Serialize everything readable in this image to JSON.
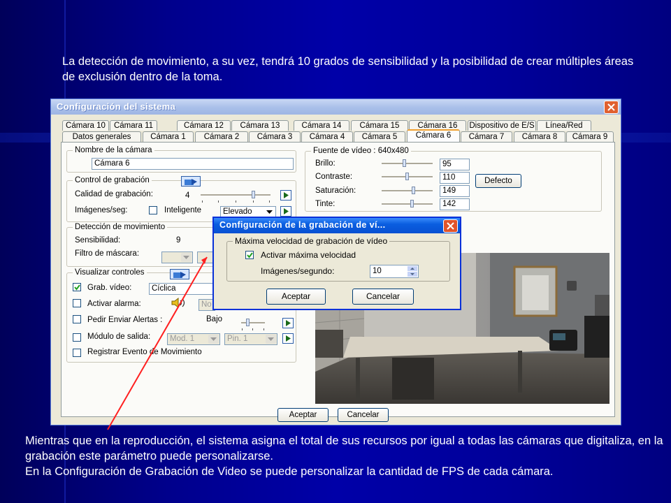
{
  "slide": {
    "top_text": "La detección de movimiento, a su vez, tendrá 10 grados de sensibilidad y la posibilidad de crear múltiples áreas de exclusión dentro de la toma.",
    "bottom_line1": "Mientras que en la reproducción, el sistema asigna el total de sus recursos por igual a todas las cámaras que digitaliza, en la grabación este parámetro puede personalizarse.",
    "bottom_line2": "En la Configuración de Grabación de Video se puede personalizar la cantidad de FPS de cada cámara."
  },
  "window": {
    "title": "Configuración del sistema",
    "tabs_row1": [
      "Cámara 10",
      "Cámara 11",
      "Cámara 12",
      "Cámara 13",
      "Cámara 14",
      "Cámara 15",
      "Cámara 16",
      "Dispositivo de E/S",
      "Línea/Red"
    ],
    "tabs_row2": [
      "Datos generales",
      "Cámara 1",
      "Cámara 2",
      "Cámara 3",
      "Cámara 4",
      "Cámara 5",
      "Cámara 6",
      "Cámara 7",
      "Cámara 8",
      "Cámara 9"
    ],
    "active_tab": "Cámara 6",
    "camera_name_group": "Nombre de la cámara",
    "camera_name": "Cámara 6",
    "recording": {
      "group": "Control de grabación",
      "quality_label": "Calidad de grabación:",
      "quality_value": "4",
      "quality_level": 0.75,
      "fps_label": "Imágenes/seg:",
      "smart_label": "Inteligente",
      "smart_checked": false,
      "fps_select": "Elevado"
    },
    "motion": {
      "group": "Detección de movimiento",
      "sensitivity_label": "Sensibilidad:",
      "sensitivity_value": "9",
      "mask_label": "Filtro de máscara:"
    },
    "controls": {
      "group": "Visualizar controles",
      "rec_video_label": "Grab. vídeo:",
      "rec_video_checked": true,
      "rec_video_select": "Cíclica",
      "alarm_label": "Activar alarma:",
      "alarm_select": "No",
      "alerts_label": "Pedir Enviar Alertas :",
      "alerts_level": "Bajo",
      "output_label": "Módulo de salida:",
      "module_select": "Mod. 1",
      "pin_select": "Pin. 1",
      "log_label": "Registrar Evento de Movimiento"
    },
    "video_source": {
      "group": "Fuente de vídeo : 640x480",
      "brightness_label": "Brillo:",
      "brightness": "95",
      "contrast_label": "Contraste:",
      "contrast": "110",
      "saturation_label": "Saturación:",
      "saturation": "149",
      "hue_label": "Tinte:",
      "hue": "142",
      "default_button": "Defecto"
    },
    "accept_button": "Aceptar",
    "cancel_button": "Cancelar"
  },
  "dialog": {
    "title": "Configuración de la grabación de ví...",
    "group": "Máxima velocidad de grabación de vídeo",
    "max_speed_label": "Activar máxima velocidad",
    "max_speed_checked": true,
    "fps_label": "Imágenes/segundo:",
    "fps_value": "10",
    "accept_button": "Aceptar",
    "cancel_button": "Cancelar"
  },
  "colors": {
    "slide_background": "#0000a0",
    "xp_title_blue": "#0a5ee0",
    "pointer_line": "#ff2020",
    "close_button": "#e06030"
  }
}
